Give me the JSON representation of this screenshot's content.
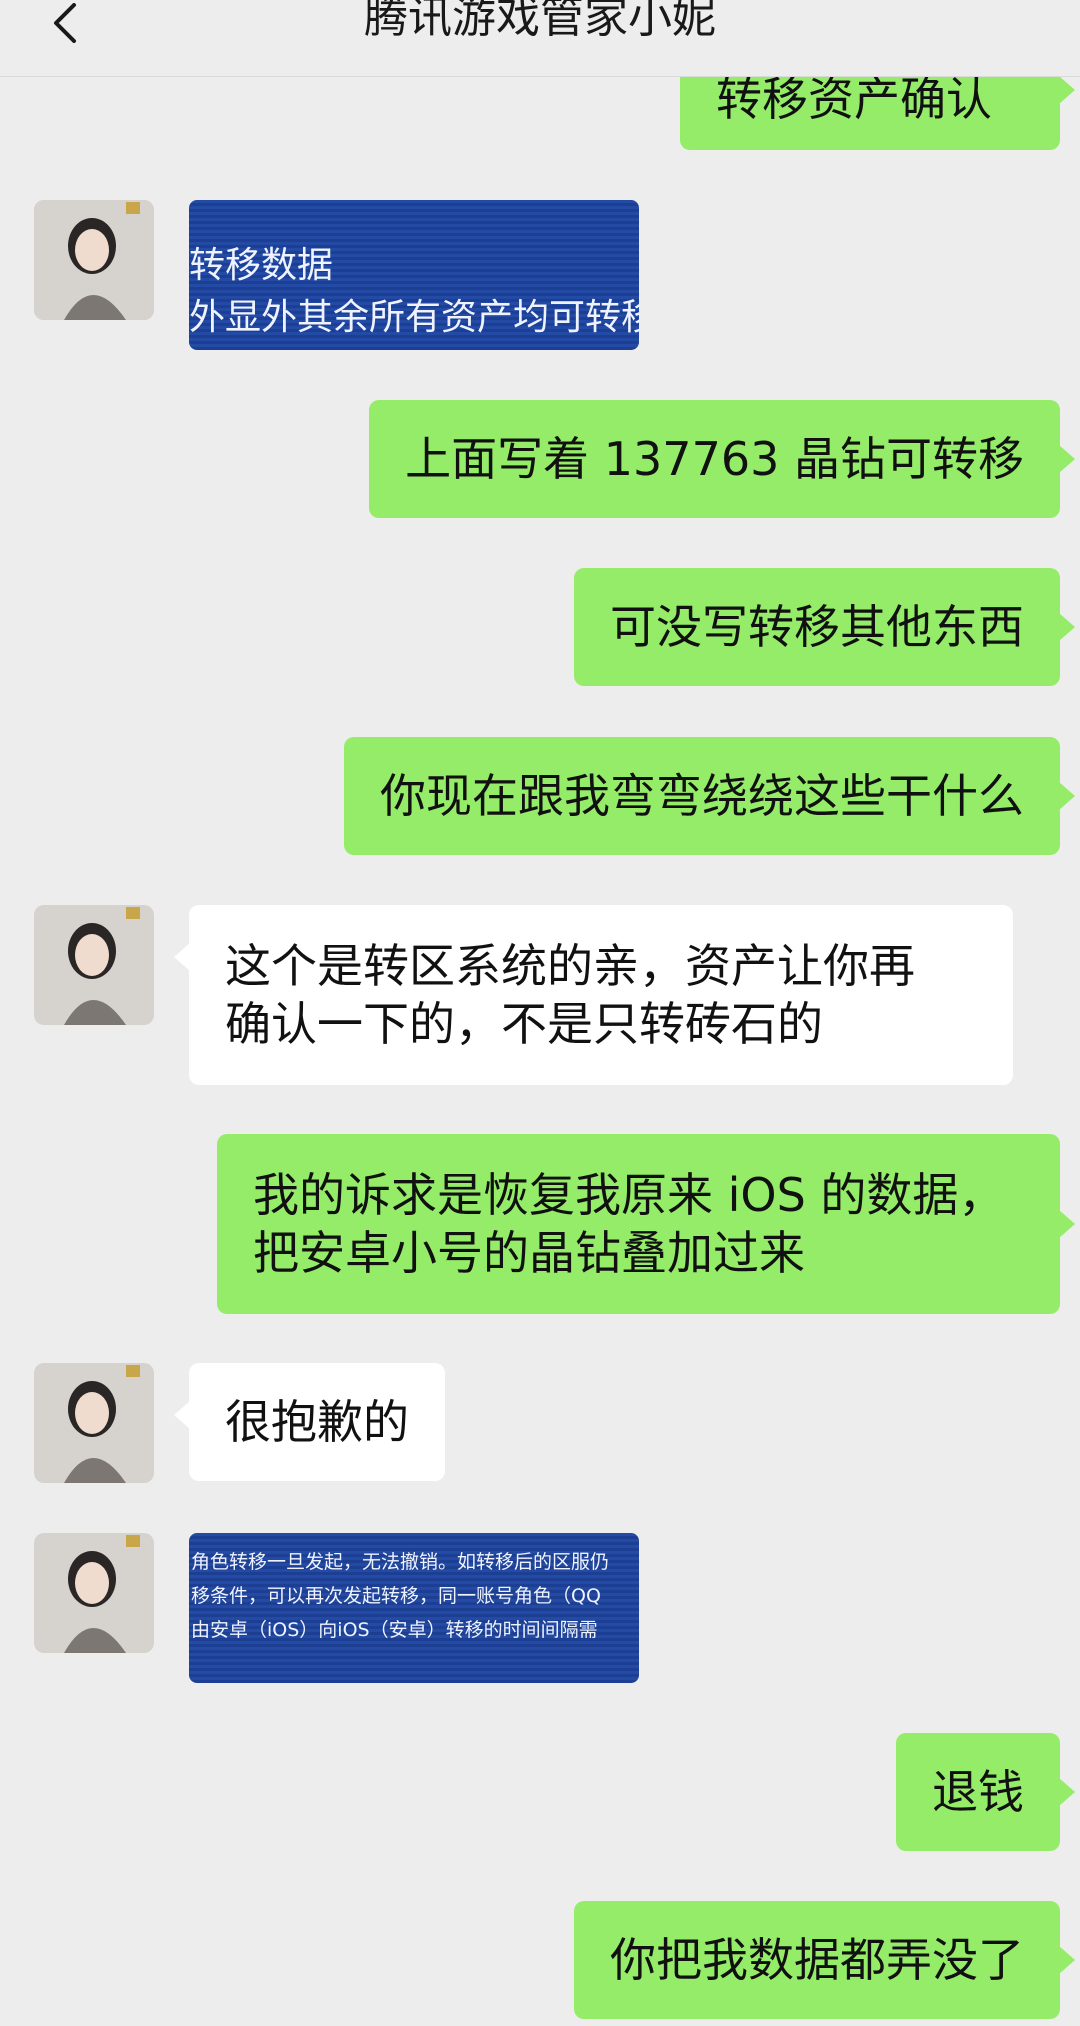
{
  "header": {
    "title": "腾讯游戏管家小妮",
    "back_icon": "chevron-left-icon"
  },
  "colors": {
    "background": "#ededed",
    "sent_bubble": "#95ec69",
    "received_bubble": "#ffffff",
    "image_blue": "#1c3f93"
  },
  "messages": [
    {
      "from": "me",
      "type": "text",
      "lines": [
        "转移资产确认"
      ]
    },
    {
      "from": "agent",
      "type": "image",
      "lines": [
        "转移数据",
        "外显外其余所有资产均可转移"
      ]
    },
    {
      "from": "me",
      "type": "text",
      "lines": [
        "上面写着 137763 晶钻可转移"
      ]
    },
    {
      "from": "me",
      "type": "text",
      "lines": [
        "可没写转移其他东西"
      ]
    },
    {
      "from": "me",
      "type": "text",
      "lines": [
        "你现在跟我弯弯绕绕这些干什么"
      ]
    },
    {
      "from": "agent",
      "type": "text",
      "lines": [
        "这个是转区系统的亲，资产让你再",
        "确认一下的，不是只转砖石的"
      ]
    },
    {
      "from": "me",
      "type": "text",
      "lines": [
        "我的诉求是恢复我原来 iOS 的数据，",
        "把安卓小号的晶钻叠加过来"
      ]
    },
    {
      "from": "agent",
      "type": "text",
      "lines": [
        "很抱歉的"
      ]
    },
    {
      "from": "agent",
      "type": "image",
      "lines": [
        "角色转移一旦发起，无法撤销。如转移后的区服仍",
        "移条件，可以再次发起转移，同一账号角色（QQ",
        "由安卓（iOS）向iOS（安卓）转移的时间间隔需"
      ]
    },
    {
      "from": "me",
      "type": "text",
      "lines": [
        "退钱"
      ]
    },
    {
      "from": "me",
      "type": "text",
      "lines": [
        "你把我数据都弄没了"
      ]
    }
  ]
}
